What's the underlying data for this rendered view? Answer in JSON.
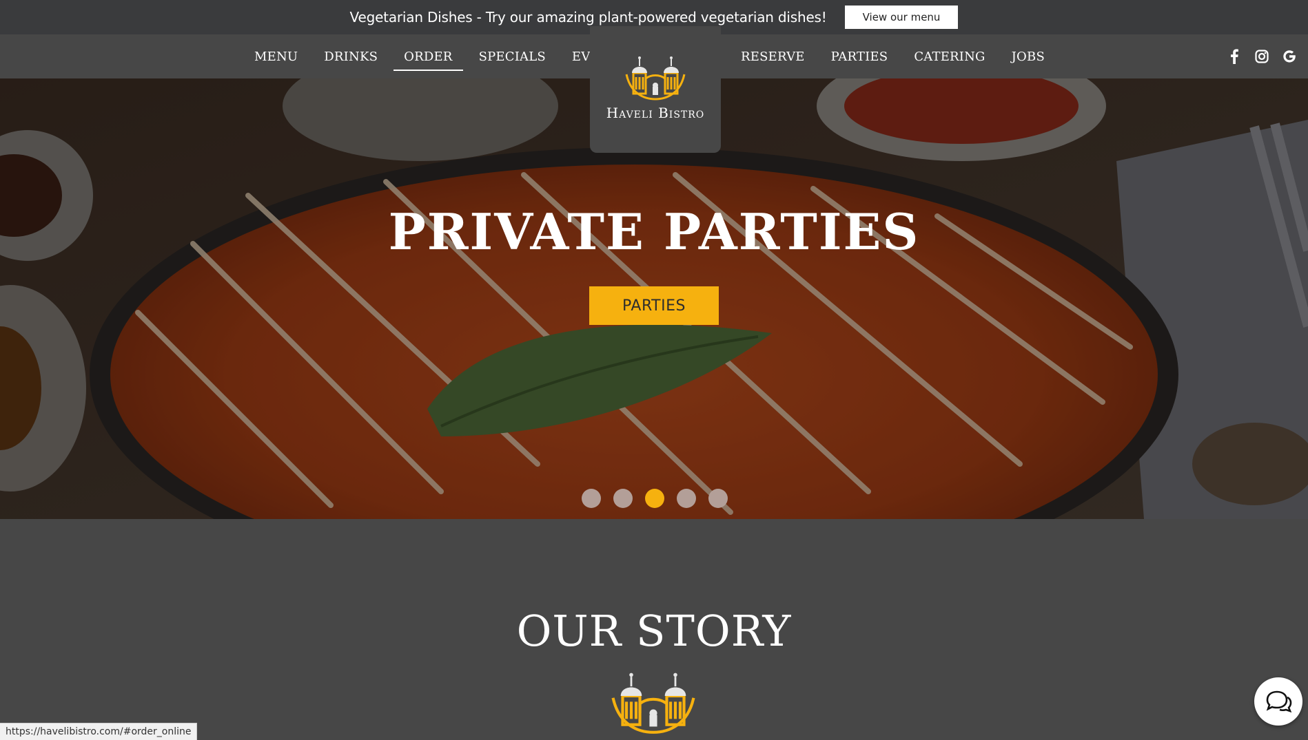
{
  "announcement": {
    "text": "Vegetarian Dishes - Try our amazing plant-powered vegetarian dishes!",
    "button_label": "View our menu"
  },
  "nav": {
    "left_items": [
      {
        "label": "MENU"
      },
      {
        "label": "DRINKS"
      },
      {
        "label": "ORDER",
        "active": true
      },
      {
        "label": "SPECIALS"
      },
      {
        "label": "EVENTS"
      }
    ],
    "right_items": [
      {
        "label": "RESERVE"
      },
      {
        "label": "PARTIES"
      },
      {
        "label": "CATERING"
      },
      {
        "label": "JOBS"
      }
    ],
    "social_icons": [
      "facebook-icon",
      "instagram-icon",
      "google-icon"
    ]
  },
  "logo": {
    "text": "Haveli Bistro",
    "accent_color": "#f6b10f"
  },
  "hero": {
    "title": "PRIVATE PARTIES",
    "button_label": "PARTIES",
    "slides_count": 5,
    "active_slide_index": 2
  },
  "story": {
    "title": "OUR STORY"
  },
  "status_bar": {
    "url": "https://havelibistro.com/#order_online"
  },
  "colors": {
    "accent": "#f6b10f",
    "bar_dark": "#3a3b3d",
    "background": "#474747"
  }
}
